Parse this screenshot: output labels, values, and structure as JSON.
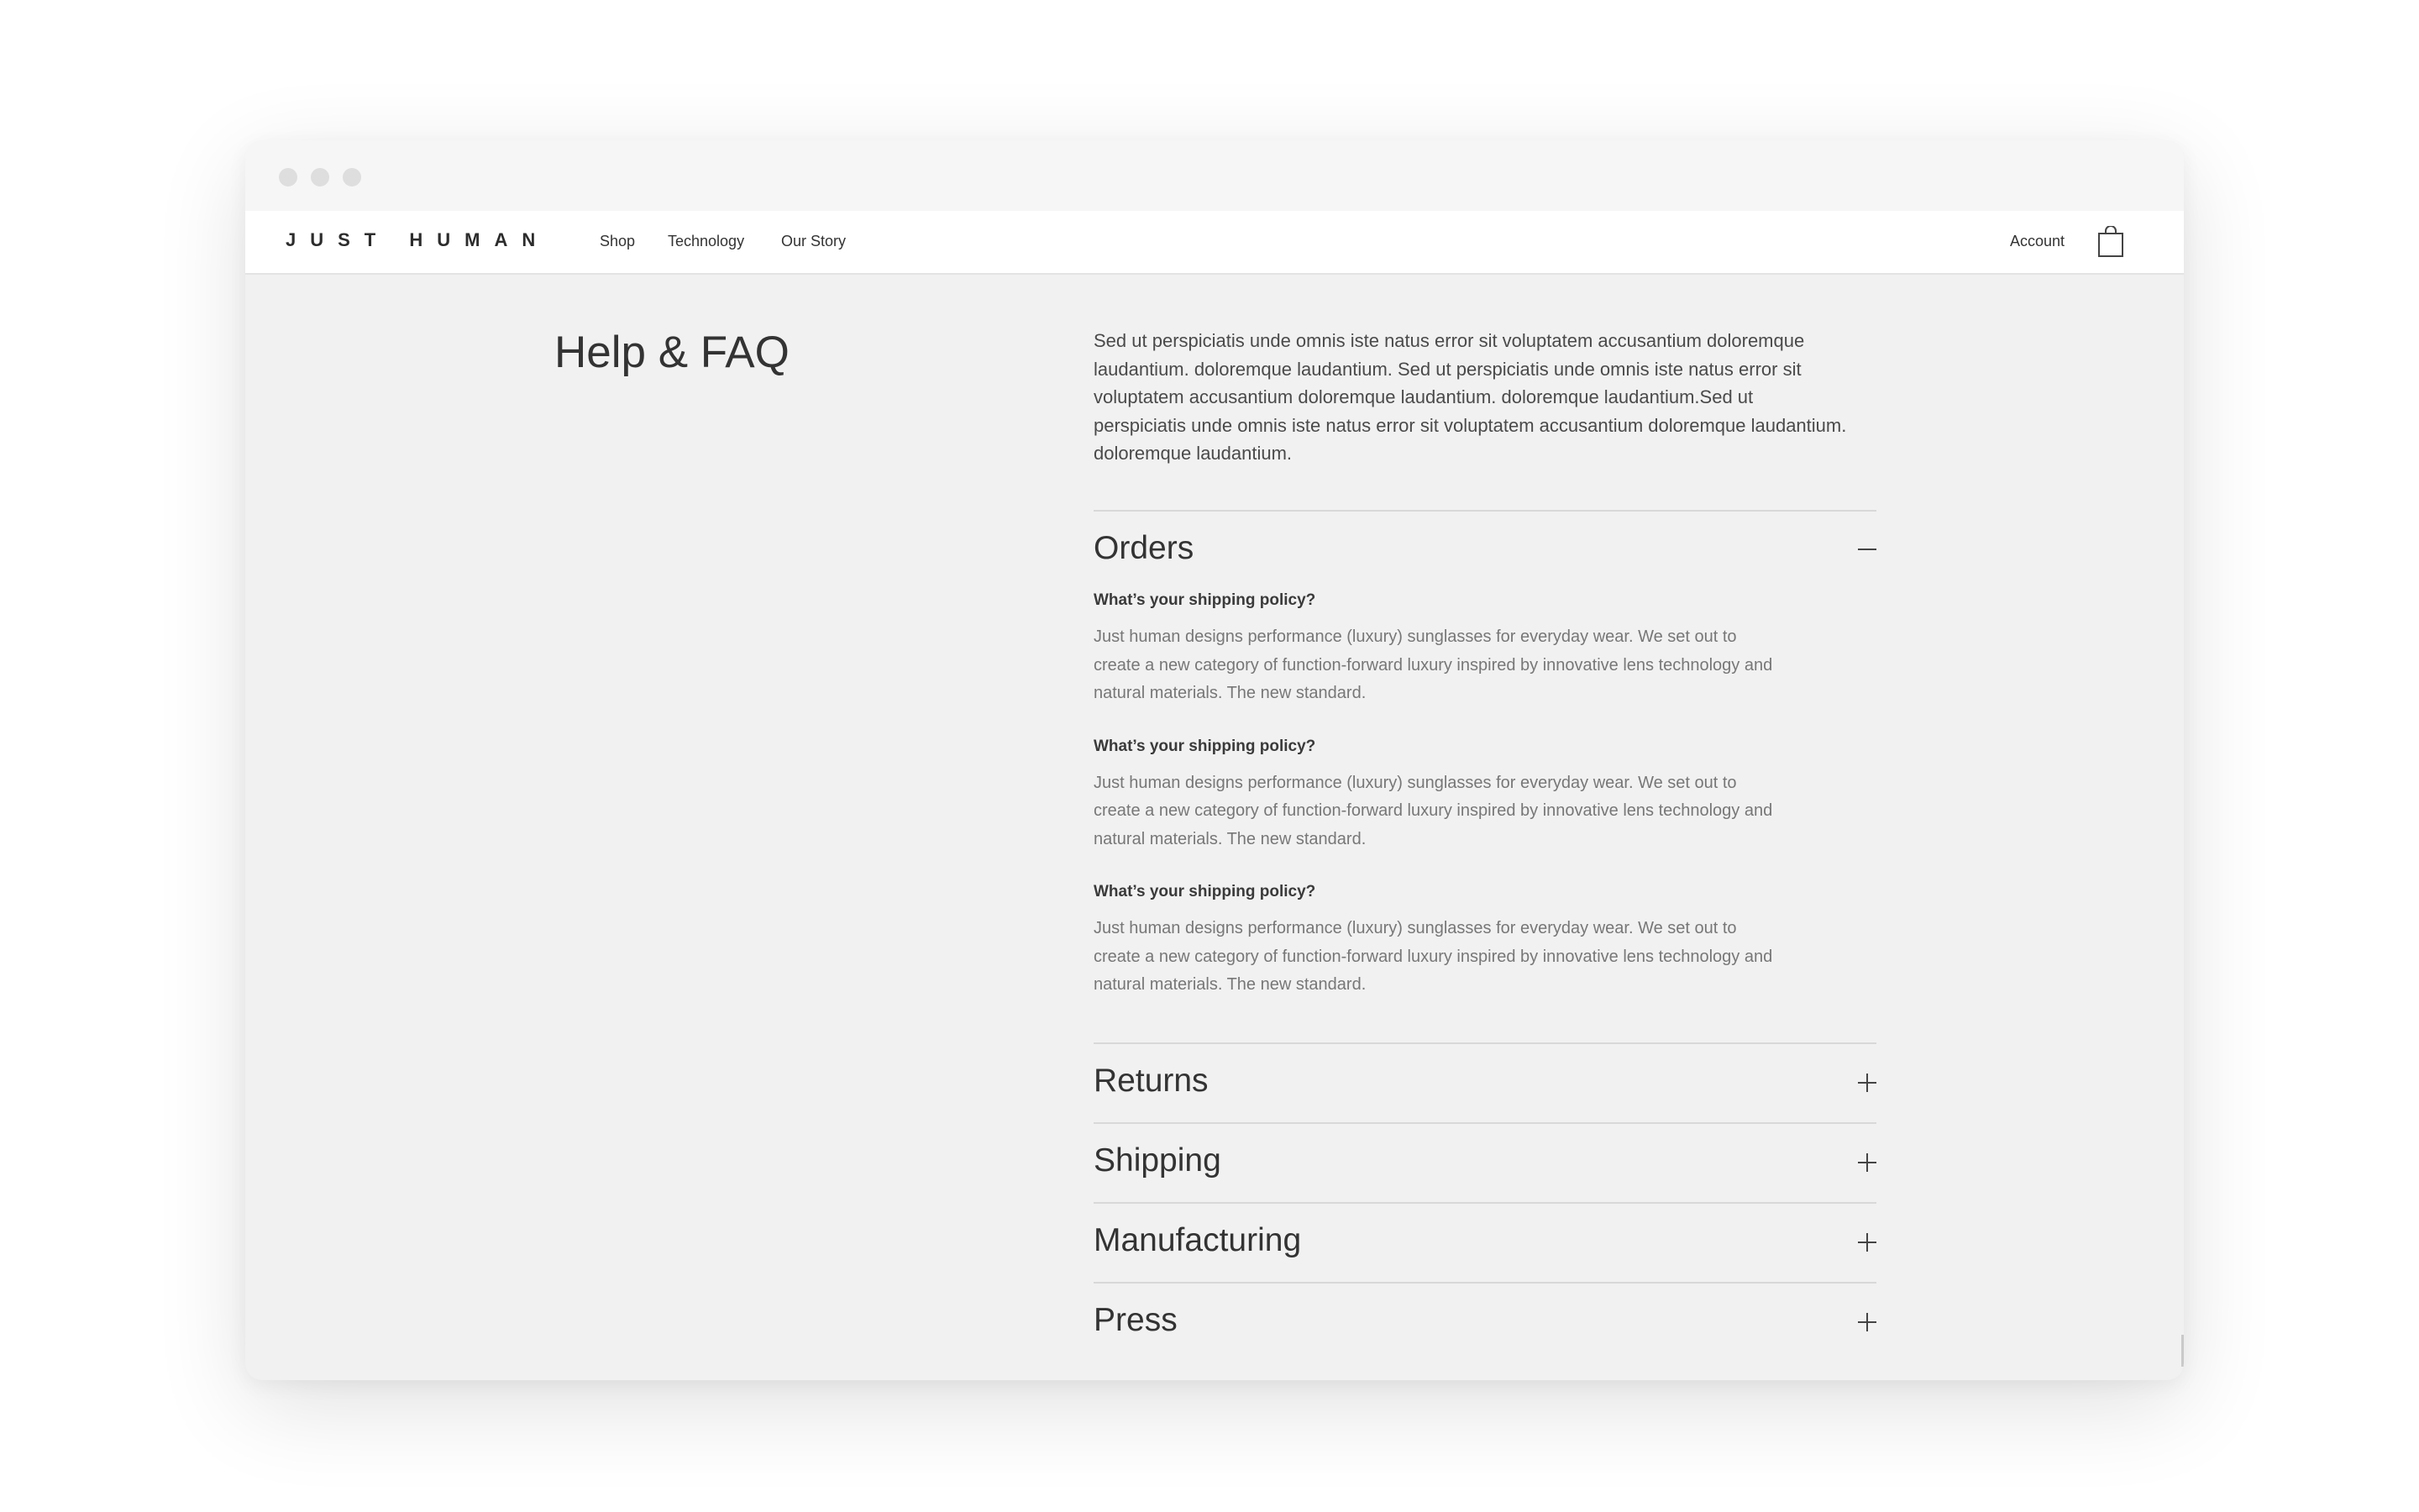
{
  "brand": {
    "logo": "JUST HUMAN"
  },
  "nav": {
    "links": [
      "Shop",
      "Technology",
      "Our Story"
    ],
    "account_label": "Account"
  },
  "page": {
    "title": "Help & FAQ",
    "intro": "Sed ut perspiciatis unde omnis iste natus error sit voluptatem accusantium doloremque laudantium.  doloremque laudantium. Sed ut perspiciatis unde omnis iste natus error sit voluptatem accusantium doloremque laudantium.  doloremque laudantium.Sed ut perspiciatis unde omnis iste natus error sit voluptatem accusantium doloremque laudantium.  doloremque laudantium."
  },
  "faq": {
    "sections": [
      {
        "title": "Orders",
        "expanded": true,
        "items": [
          {
            "question": "What’s your shipping policy?",
            "answer": "Just human designs performance (luxury) sunglasses for everyday wear. We set out to create a new category of function-forward luxury inspired by innovative lens technology and natural materials. The new standard."
          },
          {
            "question": "What’s your shipping policy?",
            "answer": "Just human designs performance (luxury) sunglasses for everyday wear. We set out to create a new category of function-forward luxury inspired by innovative lens technology and natural materials. The new standard."
          },
          {
            "question": "What’s your shipping policy?",
            "answer": "Just human designs performance (luxury) sunglasses for everyday wear. We set out to create a new category of function-forward luxury inspired by innovative lens technology and natural materials. The new standard."
          }
        ]
      },
      {
        "title": "Returns",
        "expanded": false
      },
      {
        "title": "Shipping",
        "expanded": false
      },
      {
        "title": "Manufacturing",
        "expanded": false
      },
      {
        "title": "Press",
        "expanded": false
      }
    ]
  },
  "icons": {
    "bag": "shopping-bag-icon",
    "expanded": "minus-icon",
    "collapsed": "plus-icon"
  },
  "colors": {
    "page_background": "#f1f1f1",
    "navbar_background": "#ffffff",
    "text": "#333333",
    "muted_text": "#777777"
  }
}
